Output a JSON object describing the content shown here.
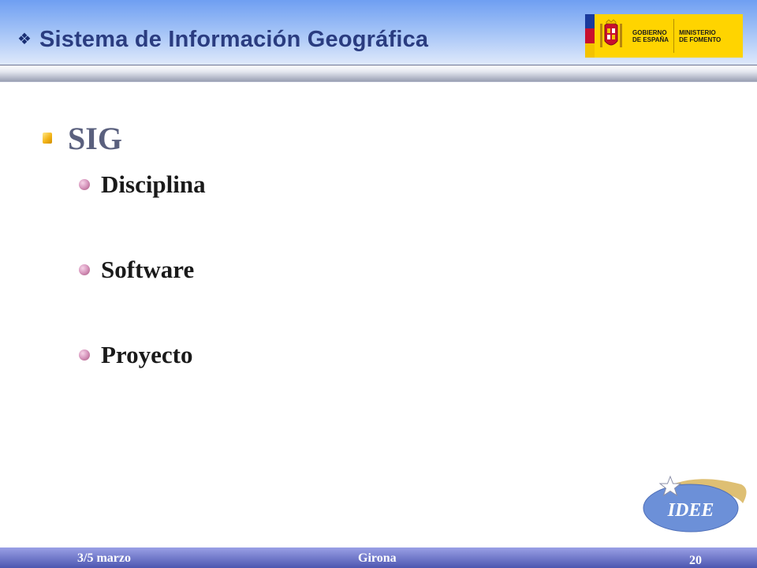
{
  "header": {
    "title": "Sistema de Información Geográfica",
    "title_bullet": "❖",
    "logo": {
      "left_text": "GOBIERNO\nDE ESPAÑA",
      "right_text": "MINISTERIO\nDE FOMENTO"
    }
  },
  "slide": {
    "heading": "SIG",
    "items": [
      {
        "label": "Disciplina"
      },
      {
        "label": "Software"
      },
      {
        "label": "Proyecto"
      }
    ]
  },
  "badge": {
    "text": "IDEE"
  },
  "footer": {
    "date": "3/5 marzo",
    "place": "Girona",
    "page": "20"
  },
  "colors": {
    "header_gradient_top": "#6f9ff2",
    "title_text": "#2a3c80",
    "heading_text": "#5a607e",
    "footer_bar": "#4c56b0",
    "badge_fill": "#6c90d8",
    "badge_swoosh": "#d8b45a",
    "logo_yellow": "#ffd400"
  },
  "icons": {
    "title_bullet": "diamond-four-icon",
    "heading_bullet": "gold-square-bullet-icon",
    "item_bullet": "pink-sphere-bullet-icon",
    "badge_star": "star-icon",
    "logo_crest": "coat-of-arms-icon"
  }
}
